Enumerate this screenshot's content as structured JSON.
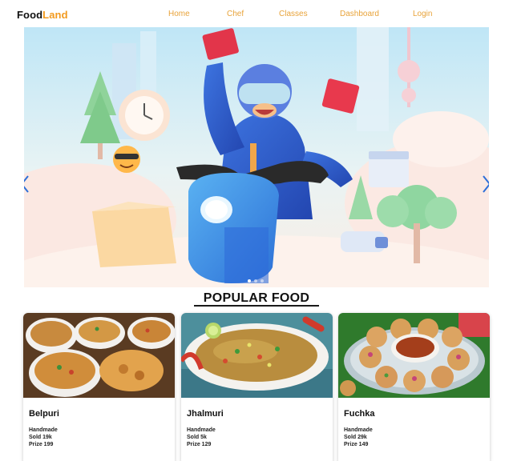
{
  "brand": {
    "part1": "Food",
    "part2": "Land"
  },
  "nav": [
    {
      "label": "Home"
    },
    {
      "label": "Chef"
    },
    {
      "label": "Classes"
    },
    {
      "label": "Dashboard"
    },
    {
      "label": "Login"
    }
  ],
  "carousel": {
    "slide_count": 3,
    "active_slide": 1,
    "prev_icon": "chevron-left-icon",
    "next_icon": "chevron-right-icon"
  },
  "section": {
    "title": "POPULAR FOOD"
  },
  "foods": [
    {
      "name": "Belpuri",
      "tag": "Handmade",
      "sold": "Sold 19k",
      "price": "Prize 199"
    },
    {
      "name": "Jhalmuri",
      "tag": "Handmade",
      "sold": "Sold 5k",
      "price": "Prize 129"
    },
    {
      "name": "Fuchka",
      "tag": "Handmade",
      "sold": "Sold 29k",
      "price": "Prize 149"
    }
  ],
  "colors": {
    "brand_accent": "#f29a1f",
    "nav_text": "#e8a33a",
    "rider_jacket": "#2f5fd0",
    "scooter": "#3f8fe6"
  }
}
